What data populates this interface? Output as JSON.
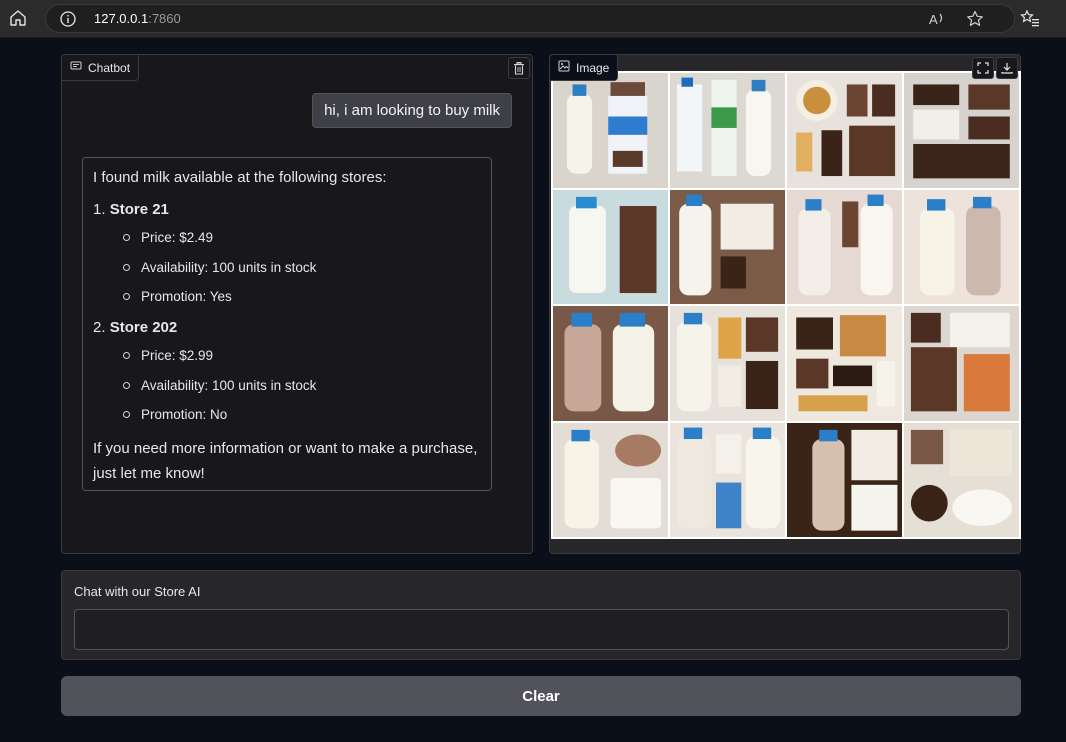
{
  "browser": {
    "url_host": "127.0.0.1",
    "url_port": ":7860"
  },
  "chatbot": {
    "label": "Chatbot",
    "user_message": "hi, i am looking to buy milk",
    "bot_message": {
      "intro": "I found milk available at the following stores:",
      "stores": [
        {
          "number": "1.",
          "name": "Store 21",
          "details": [
            "Price: $2.49",
            "Availability: 100 units in stock",
            "Promotion: Yes"
          ]
        },
        {
          "number": "2.",
          "name": "Store 202",
          "details": [
            "Price: $2.99",
            "Availability: 100 units in stock",
            "Promotion: No"
          ]
        }
      ],
      "outro": "If you need more information or want to make a purchase, just let me know!"
    }
  },
  "image_panel": {
    "label": "Image"
  },
  "input": {
    "label": "Chat with our Store AI",
    "value": "",
    "placeholder": ""
  },
  "clear_button": {
    "label": "Clear"
  },
  "colors": {
    "background": "#0b0f19",
    "panel": "#27272a",
    "button": "#52525b"
  }
}
